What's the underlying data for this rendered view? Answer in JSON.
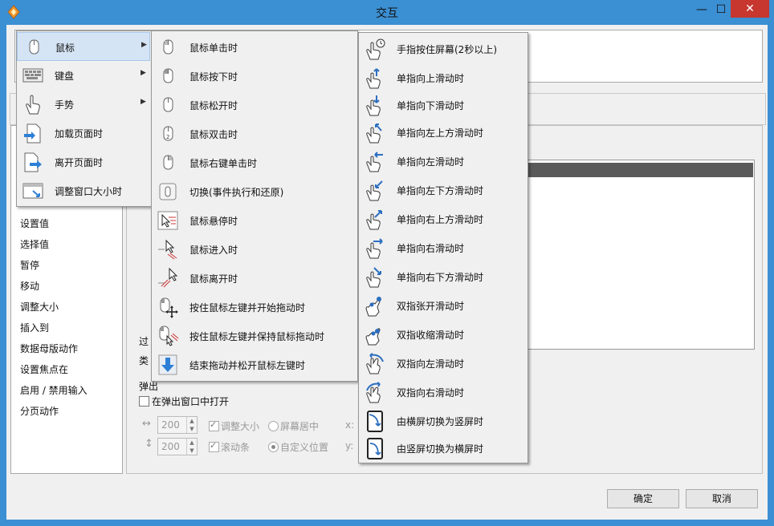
{
  "window": {
    "title": "交互",
    "minimize": "—",
    "maximize": "☐",
    "close": "✕"
  },
  "left_panel": {
    "items": [
      "设置值",
      "选择值",
      "暂停",
      "移动",
      "调整大小",
      "插入到",
      "数据母版动作",
      "设置焦点在",
      "启用 / 禁用输入",
      "分页动作"
    ]
  },
  "right_panel": {
    "filter_label": "过",
    "type_label": "类",
    "popup_label": "弹出",
    "open_in_popup": "在弹出窗口中打开",
    "width_value": "200",
    "height_value": "200",
    "resize_label": "调整大小",
    "center_label": "屏幕居中",
    "scrollbar_label": "滚动条",
    "custom_pos_label": "自定义位置",
    "x_label": "x:",
    "y_label": "y:"
  },
  "buttons": {
    "ok": "确定",
    "cancel": "取消"
  },
  "menu_level1": [
    {
      "label": "鼠标",
      "icon": "mouse-icon",
      "has_sub": true,
      "selected": true
    },
    {
      "label": "键盘",
      "icon": "keyboard-icon",
      "has_sub": true
    },
    {
      "label": "手势",
      "icon": "gesture-icon",
      "has_sub": true
    },
    {
      "label": "加载页面时",
      "icon": "page-load-icon",
      "has_sub": false
    },
    {
      "label": "离开页面时",
      "icon": "page-leave-icon",
      "has_sub": false
    },
    {
      "label": "调整窗口大小时",
      "icon": "window-resize-icon",
      "has_sub": false
    }
  ],
  "menu_level2": [
    {
      "label": "鼠标单击时",
      "icon": "mouse-click-icon"
    },
    {
      "label": "鼠标按下时",
      "icon": "mouse-down-icon"
    },
    {
      "label": "鼠标松开时",
      "icon": "mouse-up-icon"
    },
    {
      "label": "鼠标双击时",
      "icon": "mouse-double-click-icon"
    },
    {
      "label": "鼠标右键单击时",
      "icon": "mouse-right-click-icon"
    },
    {
      "label": "切换(事件执行和还原)",
      "icon": "toggle-icon"
    },
    {
      "label": "鼠标悬停时",
      "icon": "mouse-hover-icon"
    },
    {
      "label": "鼠标进入时",
      "icon": "mouse-enter-icon"
    },
    {
      "label": "鼠标离开时",
      "icon": "mouse-leave-icon"
    },
    {
      "label": "按住鼠标左键并开始拖动时",
      "icon": "drag-start-icon"
    },
    {
      "label": "按住鼠标左键并保持鼠标拖动时",
      "icon": "drag-move-icon"
    },
    {
      "label": "结束拖动并松开鼠标左键时",
      "icon": "drag-end-icon"
    }
  ],
  "menu_level3": [
    {
      "label": "手指按住屏幕(2秒以上)",
      "icon": "finger-hold-icon"
    },
    {
      "label": "单指向上滑动时",
      "icon": "swipe-up-icon"
    },
    {
      "label": "单指向下滑动时",
      "icon": "swipe-down-icon"
    },
    {
      "label": "单指向左上方滑动时",
      "icon": "swipe-up-left-icon"
    },
    {
      "label": "单指向左滑动时",
      "icon": "swipe-left-icon"
    },
    {
      "label": "单指向左下方滑动时",
      "icon": "swipe-down-left-icon"
    },
    {
      "label": "单指向右上方滑动时",
      "icon": "swipe-up-right-icon"
    },
    {
      "label": "单指向右滑动时",
      "icon": "swipe-right-icon"
    },
    {
      "label": "单指向右下方滑动时",
      "icon": "swipe-down-right-icon"
    },
    {
      "label": "双指张开滑动时",
      "icon": "pinch-out-icon"
    },
    {
      "label": "双指收缩滑动时",
      "icon": "pinch-in-icon"
    },
    {
      "label": "双指向左滑动时",
      "icon": "two-finger-left-icon"
    },
    {
      "label": "双指向右滑动时",
      "icon": "two-finger-right-icon"
    },
    {
      "label": "由横屏切换为竖屏时",
      "icon": "landscape-to-portrait-icon"
    },
    {
      "label": "由竖屏切换为横屏时",
      "icon": "portrait-to-landscape-icon"
    }
  ]
}
